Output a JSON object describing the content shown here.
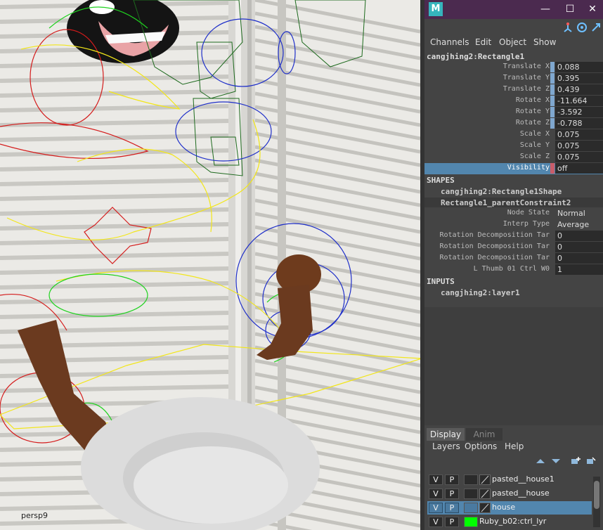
{
  "viewport": {
    "camera_label": "persp9"
  },
  "window": {
    "logo": "M",
    "minimize": "—",
    "maximize": "☐",
    "close": "✕"
  },
  "toolbar_icons": [
    "axis-icon",
    "camera-rotate-icon",
    "expand-icon"
  ],
  "menus": [
    "Channels",
    "Edit",
    "Object",
    "Show"
  ],
  "node": {
    "name": "cangjhing2:Rectangle1",
    "attributes": [
      {
        "label": "Translate X",
        "value": "0.088",
        "keyed": true
      },
      {
        "label": "Translate Y",
        "value": "0.395",
        "keyed": true
      },
      {
        "label": "Translate Z",
        "value": "0.439",
        "keyed": true
      },
      {
        "label": "Rotate X",
        "value": "-11.664",
        "keyed": true
      },
      {
        "label": "Rotate Y",
        "value": "-3.592",
        "keyed": true
      },
      {
        "label": "Rotate Z",
        "value": "-0.788",
        "keyed": true
      },
      {
        "label": "Scale X",
        "value": "0.075",
        "keyed": false
      },
      {
        "label": "Scale Y",
        "value": "0.075",
        "keyed": false
      },
      {
        "label": "Scale Z",
        "value": "0.075",
        "keyed": false
      },
      {
        "label": "Visibility",
        "value": "off",
        "keyed": true
      }
    ]
  },
  "shapes": {
    "header": "SHAPES",
    "items": [
      "cangjhing2:Rectangle1Shape",
      "Rectangle1_parentConstraint2"
    ],
    "attributes": [
      {
        "label": "Node State",
        "value": "Normal"
      },
      {
        "label": "Interp Type",
        "value": "Average"
      },
      {
        "label": "Rotation Decomposition Tar",
        "value": "0"
      },
      {
        "label": "Rotation Decomposition Tar",
        "value": "0"
      },
      {
        "label": "Rotation Decomposition Tar",
        "value": "0"
      },
      {
        "label": "L Thumb 01 Ctrl W0",
        "value": "1"
      }
    ]
  },
  "inputs": {
    "header": "INPUTS",
    "items": [
      "cangjhing2:layer1"
    ]
  },
  "layer_editor": {
    "tabs": [
      "Display",
      "Anim"
    ],
    "menus": [
      "Layers",
      "Options",
      "Help"
    ],
    "layers": [
      {
        "v": "V",
        "p": "P",
        "name": "pasted__house1",
        "color": "",
        "selected": false
      },
      {
        "v": "V",
        "p": "P",
        "name": "pasted__house",
        "color": "",
        "selected": false
      },
      {
        "v": "V",
        "p": "P",
        "name": "house",
        "color": "",
        "selected": true
      },
      {
        "v": "V",
        "p": "P",
        "name": "Ruby_b02:ctrl_lyr",
        "color": "#00ff00",
        "selected": false
      }
    ]
  },
  "colors": {
    "title_bar": "#4b2a4f",
    "selection": "#5286ae",
    "keyed_marker": "#7fa7cf",
    "visibility_marker": "#c95d6a"
  }
}
